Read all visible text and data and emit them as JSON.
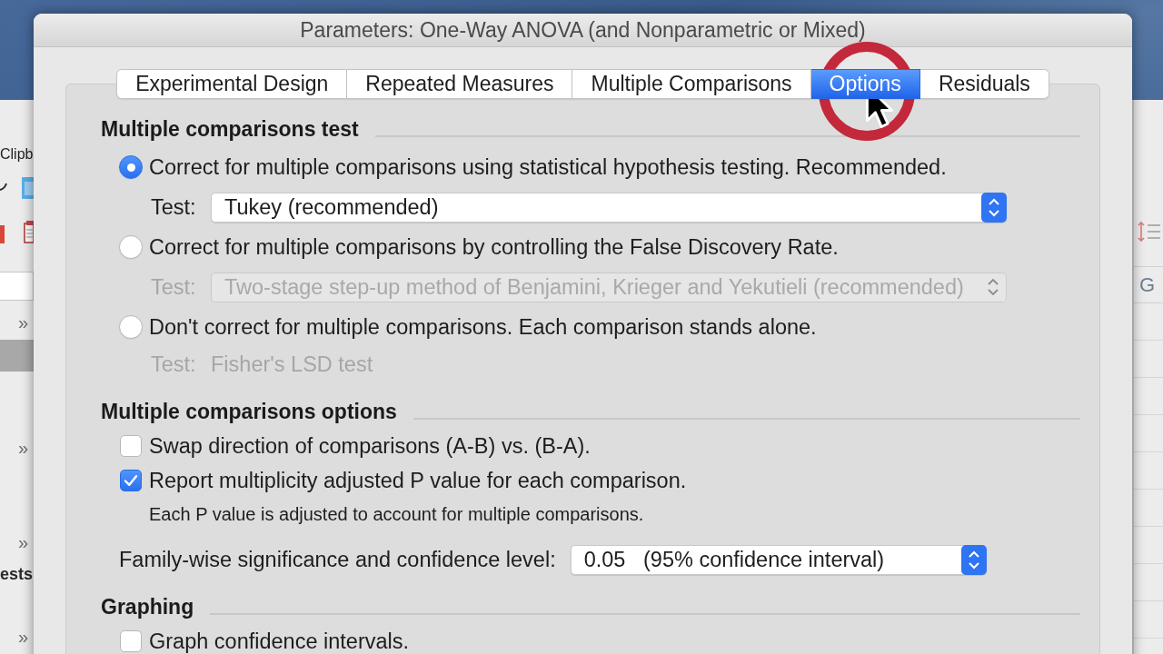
{
  "background_window": {
    "left_pane": {
      "toolbar_label": "Clipb",
      "rows": [
        {
          "kind": "field"
        },
        {
          "kind": "expander",
          "text": "»"
        },
        {
          "kind": "item",
          "selected": true
        },
        {
          "kind": "expander",
          "text": "»"
        },
        {
          "kind": "expander",
          "text": "»"
        },
        {
          "kind": "heading",
          "text": "ests",
          "selected": false
        },
        {
          "kind": "expander",
          "text": "»"
        }
      ]
    },
    "right_pane": {
      "column_header": "G"
    }
  },
  "dialog": {
    "title": "Parameters: One-Way ANOVA (and Nonparametric or Mixed)",
    "tabs": [
      {
        "label": "Experimental Design",
        "selected": false
      },
      {
        "label": "Repeated Measures",
        "selected": false
      },
      {
        "label": "Multiple Comparisons",
        "selected": false
      },
      {
        "label": "Options",
        "selected": true
      },
      {
        "label": "Residuals",
        "selected": false
      }
    ],
    "sections": [
      {
        "heading": "Multiple comparisons test",
        "items": [
          {
            "kind": "radio",
            "label": "Correct for multiple comparisons using statistical hypothesis testing. Recommended.",
            "selected": true
          },
          {
            "kind": "dropdown",
            "label": "Test:",
            "value": "Tukey (recommended)",
            "disabled": false
          },
          {
            "kind": "radio",
            "label": "Correct for multiple comparisons by controlling the False Discovery Rate.",
            "selected": false
          },
          {
            "kind": "dropdown",
            "label": "Test:",
            "value": "Two-stage step-up method of Benjamini, Krieger and Yekutieli (recommended)",
            "disabled": true
          },
          {
            "kind": "radio",
            "label": "Don't correct for multiple comparisons. Each comparison stands alone.",
            "selected": false
          },
          {
            "kind": "static",
            "label": "Test:",
            "value": "Fisher's LSD test",
            "disabled": true
          }
        ]
      },
      {
        "heading": "Multiple comparisons options",
        "items": [
          {
            "kind": "checkbox",
            "label": "Swap direction of comparisons (A-B) vs. (B-A).",
            "checked": false
          },
          {
            "kind": "checkbox",
            "label": "Report multiplicity adjusted P value for each comparison.",
            "checked": true
          },
          {
            "kind": "note",
            "text": "Each P value is adjusted to account for multiple comparisons."
          },
          {
            "kind": "labeled_dropdown",
            "label": "Family-wise significance and confidence level:",
            "value": "0.05   (95% confidence interval)",
            "disabled": false
          }
        ]
      },
      {
        "heading": "Graphing",
        "items": [
          {
            "kind": "checkbox",
            "label": "Graph confidence intervals.",
            "checked": false
          }
        ]
      }
    ]
  }
}
